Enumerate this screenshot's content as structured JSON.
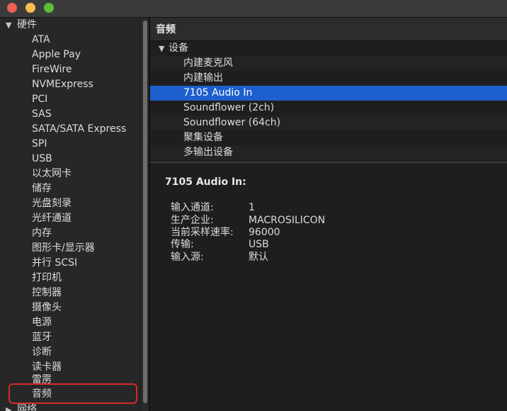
{
  "sidebar": {
    "group_hardware": "硬件",
    "items": [
      "ATA",
      "Apple Pay",
      "FireWire",
      "NVMExpress",
      "PCI",
      "SAS",
      "SATA/SATA Express",
      "SPI",
      "USB",
      "以太网卡",
      "储存",
      "光盘刻录",
      "光纤通道",
      "内存",
      "图形卡/显示器",
      "并行 SCSI",
      "打印机",
      "控制器",
      "摄像头",
      "电源",
      "蓝牙",
      "诊断",
      "读卡器",
      "雷雳",
      "音频"
    ],
    "group_network": "网络"
  },
  "main": {
    "title": "音频",
    "devices": {
      "group_label": "设备",
      "items": [
        "内建麦克风",
        "内建输出",
        "7105 Audio In",
        "Soundflower (2ch)",
        "Soundflower (64ch)",
        "聚集设备",
        "多输出设备"
      ],
      "selected": "7105 Audio In"
    },
    "detail": {
      "title": "7105 Audio In:",
      "properties": [
        {
          "key": "输入通道:",
          "value": "1"
        },
        {
          "key": "生产企业:",
          "value": "MACROSILICON"
        },
        {
          "key": "当前采样速率:",
          "value": "96000"
        },
        {
          "key": "传输:",
          "value": "USB"
        },
        {
          "key": "输入源:",
          "value": "默认"
        }
      ]
    }
  },
  "colors": {
    "selection": "#1d5fcf",
    "highlight_outline": "#d62a2a"
  }
}
